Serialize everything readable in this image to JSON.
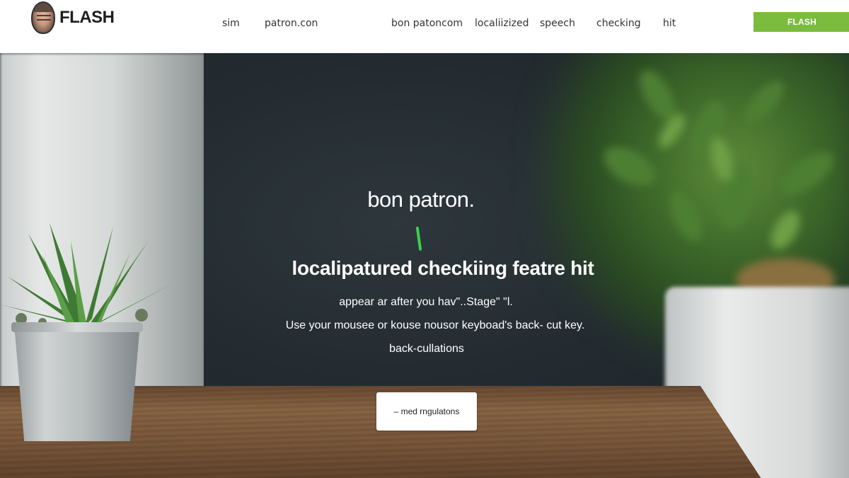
{
  "header": {
    "logo_text": "FLASH",
    "nav": [
      "sim",
      "patron.con",
      "bon patoncom",
      "localiizized",
      "speech",
      "checking",
      "hit"
    ],
    "cta_label": "FLASH"
  },
  "hero": {
    "title": "bon patron.",
    "subtitle": "localipatured checkiing featre hit",
    "desc_lines": [
      "appear ar after you hav\"..Stage\" \"l.",
      "Use your mousee or kouse nousor keyboad's back- cut key.",
      "back-cullations"
    ],
    "button_label": "– med rngulatons"
  },
  "colors": {
    "accent": "#7bbc3f",
    "hero_mark": "#37d24a"
  }
}
